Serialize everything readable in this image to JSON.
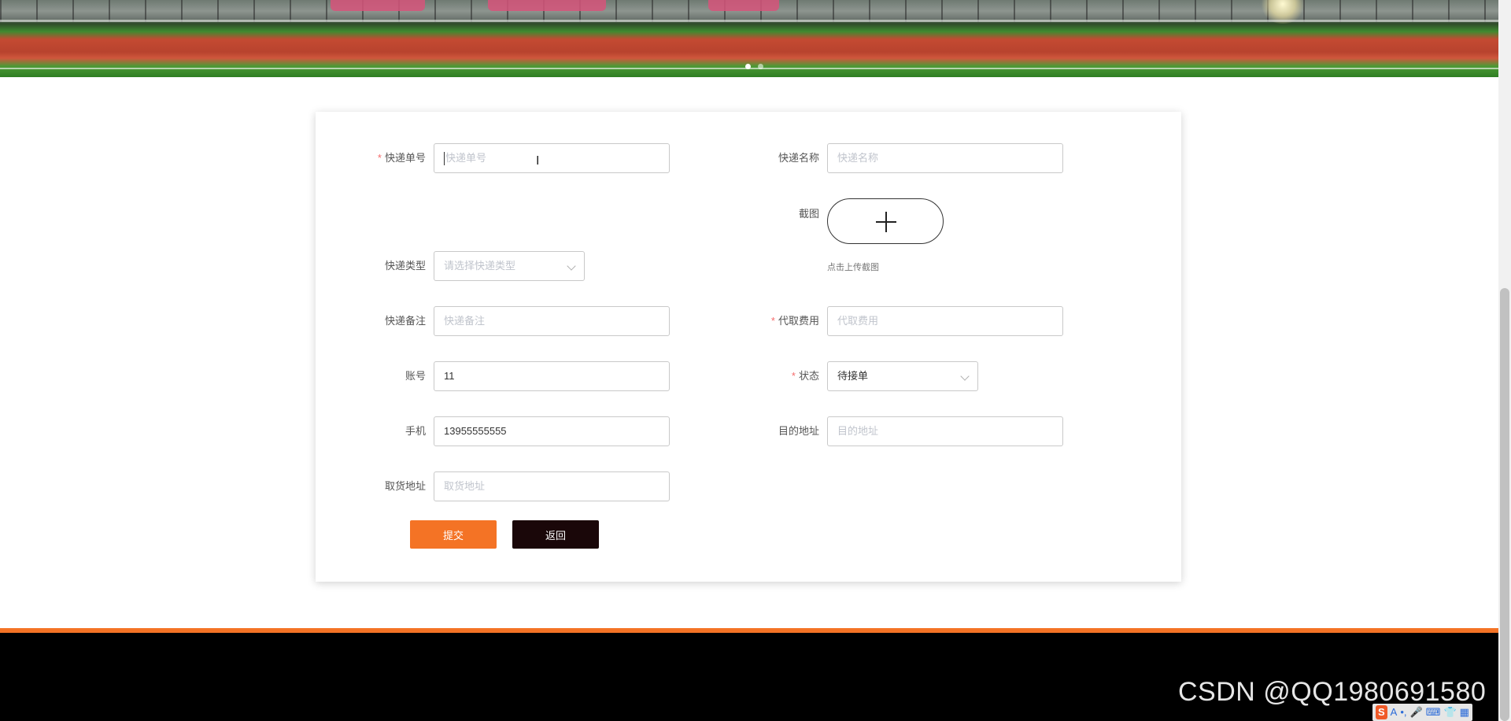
{
  "carousel": {
    "dots": 2,
    "active_index": 0
  },
  "form": {
    "express_no": {
      "label": "快递单号",
      "required": true,
      "placeholder": "快递单号",
      "value": ""
    },
    "express_name": {
      "label": "快递名称",
      "required": false,
      "placeholder": "快递名称",
      "value": ""
    },
    "screenshot": {
      "label": "截图",
      "hint": "点击上传截图"
    },
    "express_type": {
      "label": "快递类型",
      "placeholder": "请选择快递类型",
      "value": ""
    },
    "remark": {
      "label": "快递备注",
      "placeholder": "快递备注",
      "value": ""
    },
    "fee": {
      "label": "代取费用",
      "required": true,
      "placeholder": "代取费用",
      "value": ""
    },
    "account": {
      "label": "账号",
      "value": "11"
    },
    "status": {
      "label": "状态",
      "required": true,
      "value": "待接单"
    },
    "phone": {
      "label": "手机",
      "value": "13955555555"
    },
    "destination": {
      "label": "目的地址",
      "placeholder": "目的地址",
      "value": ""
    },
    "pickup": {
      "label": "取货地址",
      "placeholder": "取货地址",
      "value": ""
    }
  },
  "buttons": {
    "submit": "提交",
    "back": "返回"
  },
  "watermark": "CSDN @QQ1980691580",
  "ime": {
    "logo": "S",
    "items": [
      "A",
      "•,",
      "🎤",
      "⌨",
      "👕",
      "▦"
    ]
  },
  "colors": {
    "primary": "#f47325",
    "dark": "#1a0709",
    "required": "#f56c6c"
  }
}
